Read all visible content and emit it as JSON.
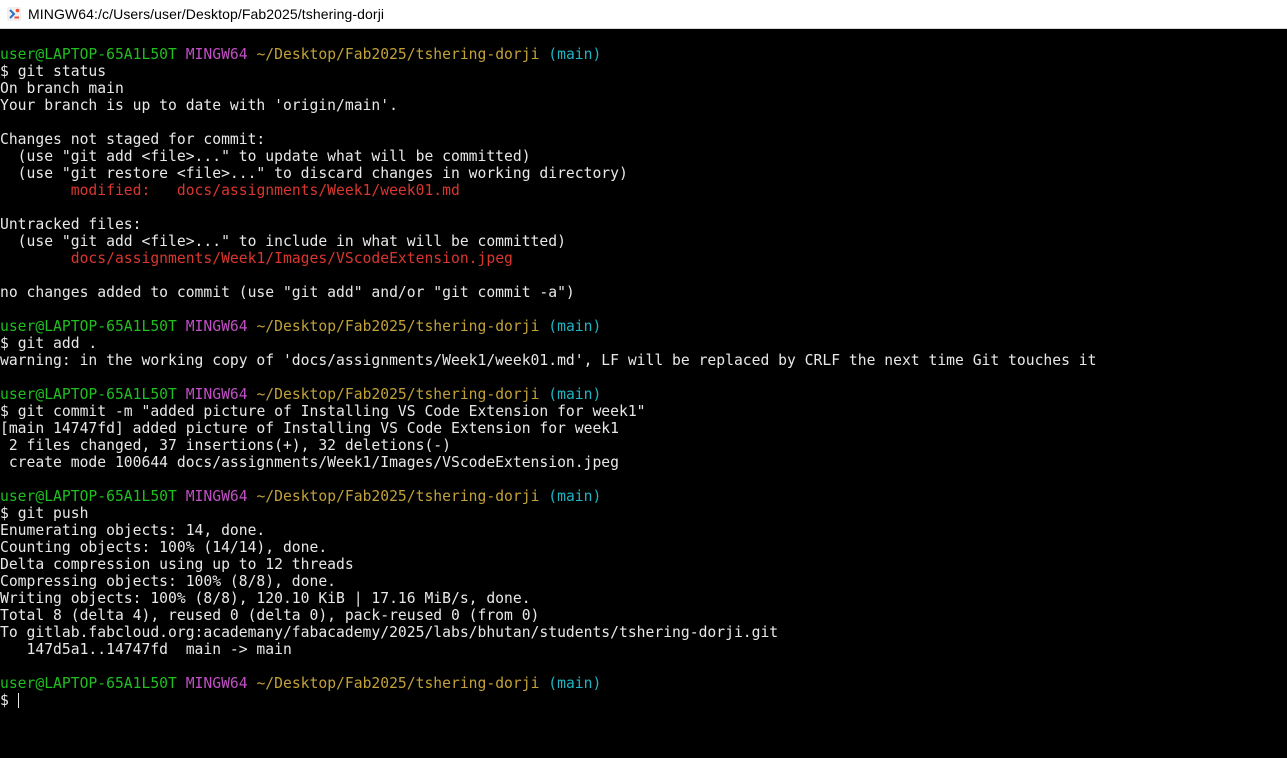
{
  "window": {
    "title": "MINGW64:/c/Users/user/Desktop/Fab2025/tshering-dorji",
    "icon": "git-bash-icon"
  },
  "colors": {
    "user": "#1fbf1f",
    "mingw": "#c04fc4",
    "path": "#c2a13a",
    "branch": "#1fb4c2",
    "modified": "#d9362f",
    "text": "#e8e8e8",
    "background": "#000000"
  },
  "prompt": {
    "user": "user@LAPTOP-65A1L50T",
    "system": "MINGW64",
    "path": "~/Desktop/Fab2025/tshering-dorji",
    "branch": "(main)",
    "symbol": "$"
  },
  "blocks": [
    {
      "command": "git status",
      "output": [
        "On branch main",
        "Your branch is up to date with 'origin/main'.",
        "",
        "Changes not staged for commit:",
        "  (use \"git add <file>...\" to update what will be committed)",
        "  (use \"git restore <file>...\" to discard changes in working directory)",
        "        modified:   docs/assignments/Week1/week01.md",
        "",
        "Untracked files:",
        "  (use \"git add <file>...\" to include in what will be committed)",
        "        docs/assignments/Week1/Images/VScodeExtension.jpeg",
        "",
        "no changes added to commit (use \"git add\" and/or \"git commit -a\")"
      ]
    },
    {
      "command": "git add .",
      "output": [
        "warning: in the working copy of 'docs/assignments/Week1/week01.md', LF will be replaced by CRLF the next time Git touches it"
      ]
    },
    {
      "command": "git commit -m \"added picture of Installing VS Code Extension for week1\"",
      "output": [
        "[main 14747fd] added picture of Installing VS Code Extension for week1",
        " 2 files changed, 37 insertions(+), 32 deletions(-)",
        " create mode 100644 docs/assignments/Week1/Images/VScodeExtension.jpeg"
      ]
    },
    {
      "command": "git push",
      "output": [
        "Enumerating objects: 14, done.",
        "Counting objects: 100% (14/14), done.",
        "Delta compression using up to 12 threads",
        "Compressing objects: 100% (8/8), done.",
        "Writing objects: 100% (8/8), 120.10 KiB | 17.16 MiB/s, done.",
        "Total 8 (delta 4), reused 0 (delta 0), pack-reused 0 (from 0)",
        "To gitlab.fabcloud.org:academany/fabacademy/2025/labs/bhutan/students/tshering-dorji.git",
        "   147d5a1..14747fd  main -> main"
      ]
    }
  ],
  "final_input": ""
}
